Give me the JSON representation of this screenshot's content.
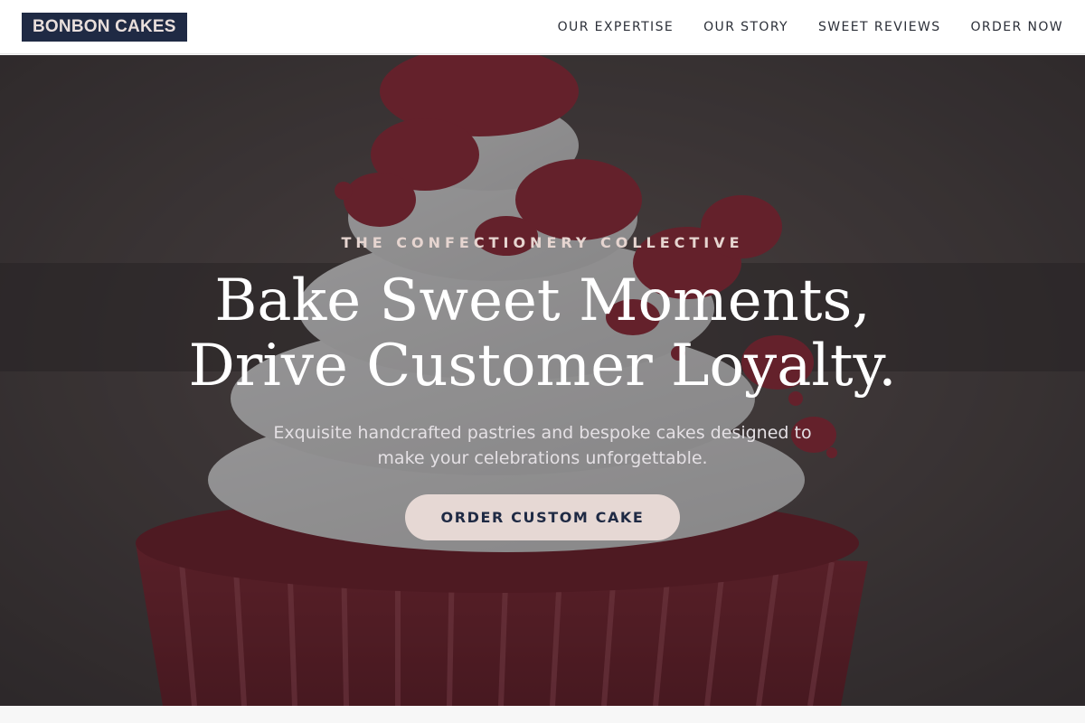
{
  "brand": {
    "name": "BONBON CAKES"
  },
  "nav": {
    "items": [
      {
        "label": "OUR EXPERTISE"
      },
      {
        "label": "OUR STORY"
      },
      {
        "label": "SWEET REVIEWS"
      },
      {
        "label": "ORDER NOW"
      }
    ]
  },
  "hero": {
    "eyebrow": "THE CONFECTIONERY COLLECTIVE",
    "title_line1": "Bake Sweet Moments,",
    "title_line2": "Drive Customer Loyalty.",
    "subtitle": "Exquisite handcrafted pastries and bespoke cakes designed to make your celebrations unforgettable.",
    "cta_label": "ORDER CUSTOM CAKE",
    "background_image": "red-velvet-cupcake-photo"
  },
  "colors": {
    "brand_dark": "#1f2a44",
    "accent_light": "#e6d8d4",
    "nav_text": "#2b2f38"
  }
}
